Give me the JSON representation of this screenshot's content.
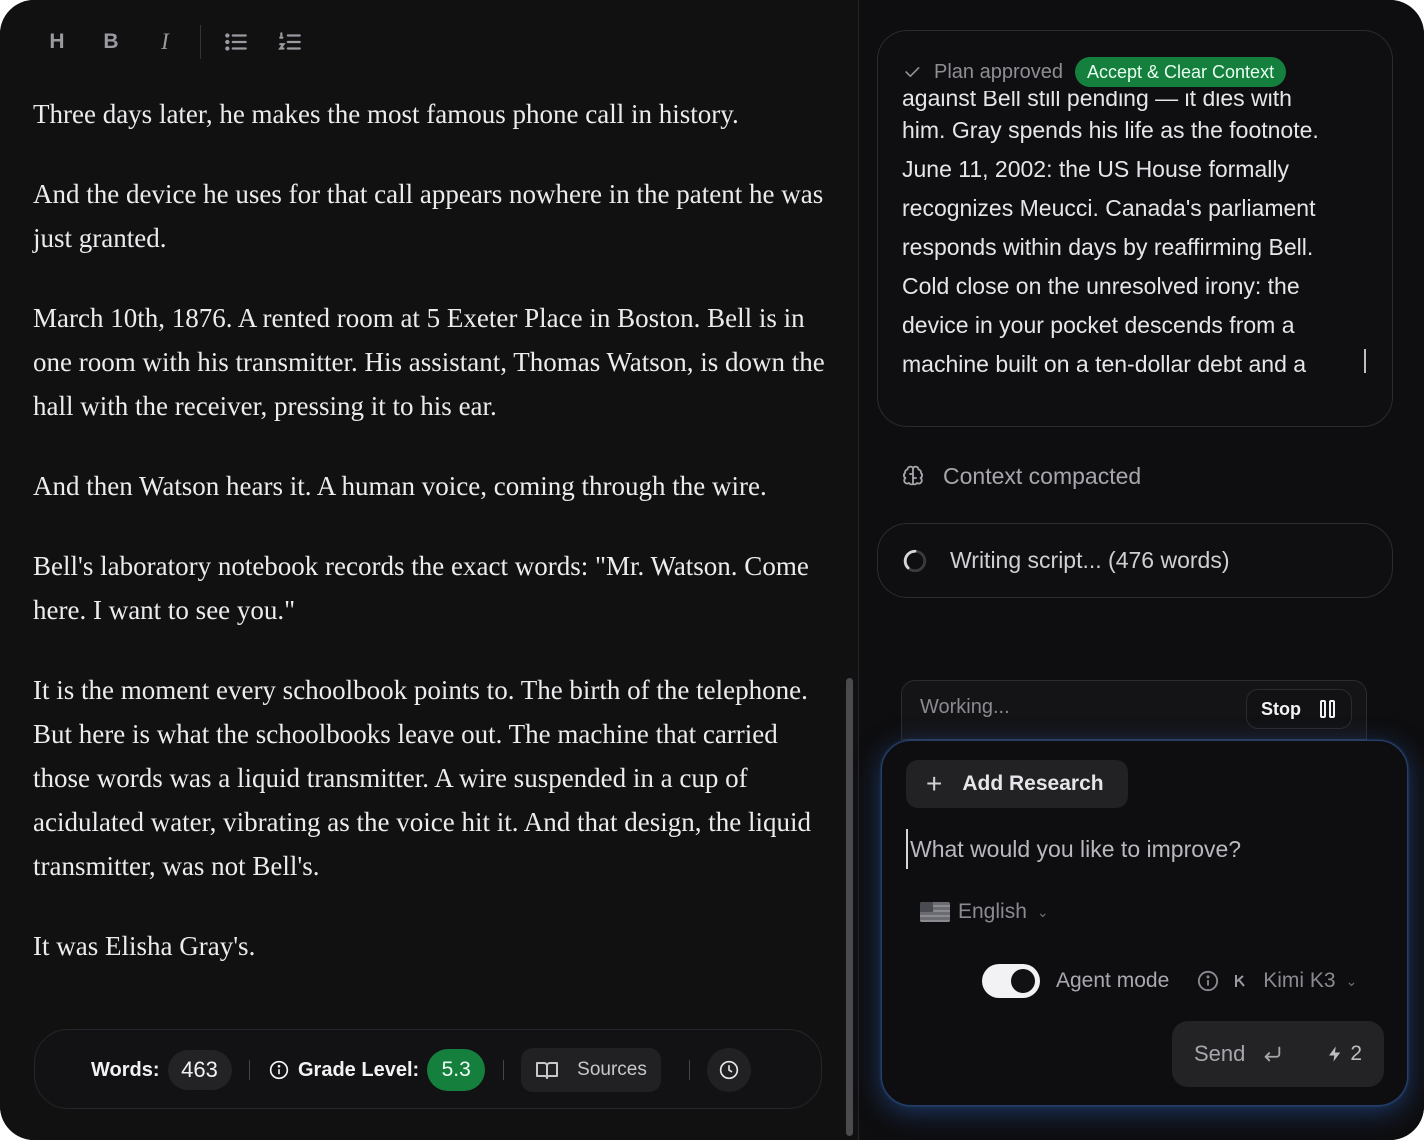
{
  "toolbar": {
    "heading_label": "H",
    "bold_label": "B",
    "italic_label": "I"
  },
  "document": {
    "paragraphs": [
      "Three days later, he makes the most famous phone call in history.",
      "And the device he uses for that call appears nowhere in the patent he was just granted.",
      "March 10th, 1876. A rented room at 5 Exeter Place in Boston. Bell is in one room with his transmitter. His assistant, Thomas Watson, is down the hall with the receiver, pressing it to his ear.",
      "And then Watson hears it. A human voice, coming through the wire.",
      "Bell's laboratory notebook records the exact words: \"Mr. Watson. Come here. I want to see you.\"",
      "It is the moment every schoolbook points to. The birth of the telephone. But here is what the schoolbooks leave out. The machine that carried those words was a liquid transmitter. A wire suspended in a cup of acidulated water, vibrating as the voice hit it. And that design, the liquid transmitter, was not Bell's.",
      "It was Elisha Gray's."
    ]
  },
  "statusbar": {
    "words_label": "Words:",
    "words_value": "463",
    "grade_label": "Grade Level:",
    "grade_value": "5.3",
    "sources_label": "Sources"
  },
  "plan": {
    "status": "Plan approved",
    "action": "Accept & Clear Context",
    "clipped_line": "against Bell still pending — it dies with",
    "lines": [
      "him. Gray spends his life as the footnote.",
      "June 11, 2002: the US House formally",
      "recognizes Meucci. Canada's parliament",
      "responds within days by reaffirming Bell.",
      "Cold close on the unresolved irony: the",
      "device in your pocket descends from a",
      "machine built on a ten-dollar debt and a"
    ]
  },
  "context": {
    "label": "Context compacted"
  },
  "writing": {
    "label": "Writing script... (476 words)"
  },
  "working": {
    "label": "Working...",
    "stop_label": "Stop"
  },
  "composer": {
    "add_research_label": "Add Research",
    "placeholder": "What would you like to improve?",
    "language": "English",
    "agent_mode_label": "Agent mode",
    "agent_mode_on": true,
    "model": "Kimi K3",
    "send_label": "Send",
    "credits": "2"
  },
  "colors": {
    "accent_green": "#15803d",
    "background": "#111112",
    "composer_glow": "#285aaa"
  }
}
